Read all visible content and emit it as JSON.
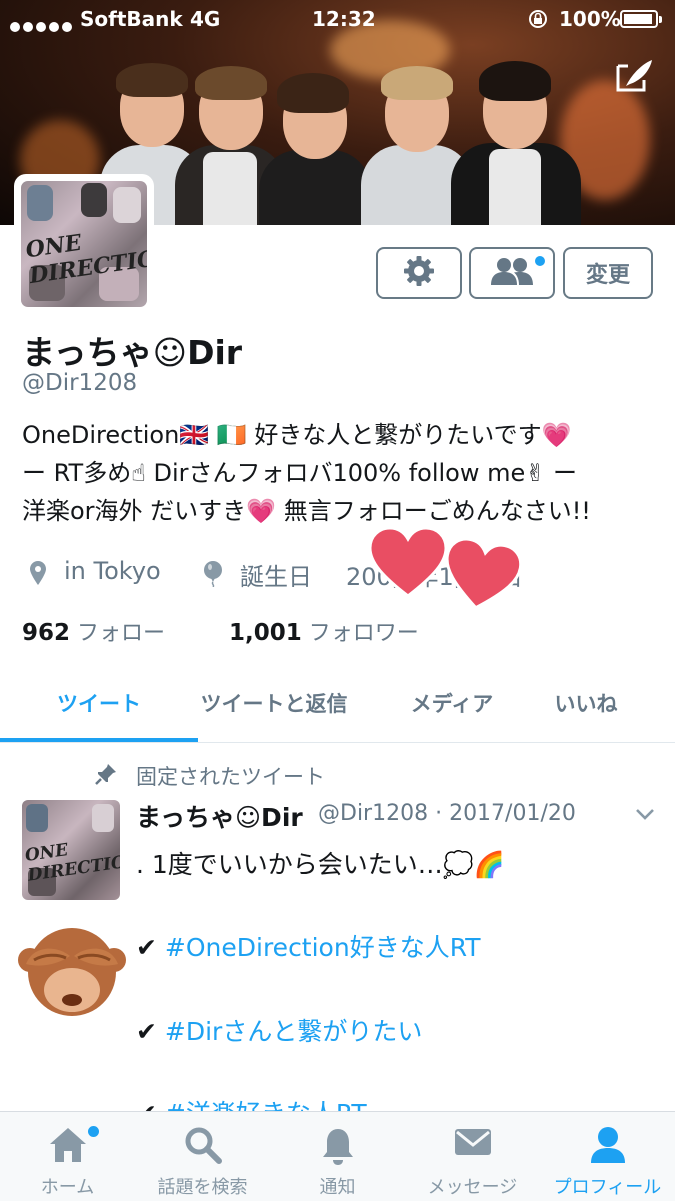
{
  "status_bar": {
    "carrier": "SoftBank",
    "network": "4G",
    "time": "12:32",
    "battery": "100%"
  },
  "profile": {
    "banner_icon": "compose-icon",
    "avatar_text": "ONE DIRECTION",
    "buttons": {
      "settings_icon": "gear-icon",
      "people_icon": "people-icon",
      "edit_label": "変更"
    },
    "display_name": "まっちゃ☺Dir",
    "handle": "@Dir1208",
    "bio": "OneDirection🇬🇧 🇮🇪 好きな人と繋がりたいです💗\nー RT多め☝ Dirさんフォロバ100% follow me✌ ー\n洋楽or海外 だいすき💗 無言フォローごめんなさい!!",
    "location": "in Tokyo",
    "birthday_label": "誕生日",
    "birthday_value": "200■年1■■日",
    "following_count": "962",
    "following_label": "フォロー",
    "followers_count": "1,001",
    "followers_label": "フォロワー"
  },
  "tabs": [
    {
      "label": "ツイート",
      "active": true
    },
    {
      "label": "ツイートと返信",
      "active": false
    },
    {
      "label": "メディア",
      "active": false
    },
    {
      "label": "いいね",
      "active": false
    }
  ],
  "pinned_tweet": {
    "pinned_label": "固定されたツイート",
    "author_name": "まっちゃ☺Dir",
    "meta": "@Dir1208 · 2017/01/20",
    "lines": [
      {
        "prefix": "",
        "text": ". 1度でいいから会いたい…💭🌈",
        "hashtag": false
      },
      {
        "prefix": "✔",
        "text": "#OneDirection好きな人RT",
        "hashtag": true
      },
      {
        "prefix": "✔",
        "text": "#Dirさんと繋がりたい",
        "hashtag": true
      },
      {
        "prefix": "✔",
        "text": "#洋楽好きな人RT",
        "hashtag": true
      }
    ]
  },
  "tab_bar": [
    {
      "label": "ホーム",
      "icon": "home-icon",
      "active": false,
      "badge": true
    },
    {
      "label": "話題を検索",
      "icon": "search-icon",
      "active": false,
      "badge": false
    },
    {
      "label": "通知",
      "icon": "bell-icon",
      "active": false,
      "badge": false
    },
    {
      "label": "メッセージ",
      "icon": "mail-icon",
      "active": false,
      "badge": false
    },
    {
      "label": "プロフィール",
      "icon": "profile-icon",
      "active": true,
      "badge": false
    }
  ],
  "colors": {
    "accent": "#1da1f2",
    "secondary_text": "#657786",
    "primary_text": "#14171a",
    "sticker_heart": "#e94e63"
  }
}
